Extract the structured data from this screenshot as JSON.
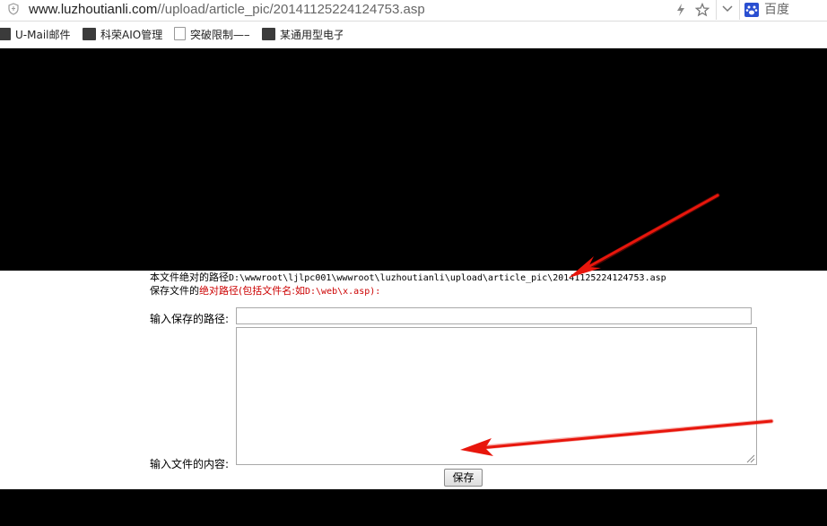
{
  "browser": {
    "url": {
      "host": "www.luzhoutianli.com",
      "path": "//upload/article_pic/20141125224124753.asp"
    },
    "search_engine": {
      "name": "百度",
      "icon": "paw-icon"
    },
    "actions": [
      {
        "name": "bolt-icon"
      },
      {
        "name": "star-icon"
      },
      {
        "name": "chevron-down-icon"
      }
    ],
    "bookmarks": [
      {
        "label": "U-Mail邮件"
      },
      {
        "label": "科荣AIO管理"
      },
      {
        "label": "突破限制——"
      },
      {
        "label": "某通用型电子"
      }
    ]
  },
  "page": {
    "abs_path_label": "本文件绝对的路径",
    "abs_path_value": "D:\\wwwroot\\ljlpc001\\wwwroot\\luzhoutianli\\upload\\article_pic\\20141125224124753.asp",
    "save_hint_prefix": "保存文件的",
    "save_hint_red": "绝对路径(包括文件名:如",
    "save_hint_example": "D:\\web\\x.asp):",
    "path_label": "输入保存的路径:",
    "path_value": "",
    "content_label": "输入文件的内容:",
    "content_value": "",
    "save_button": "保存"
  },
  "colors": {
    "black_panel": "#000000",
    "hint_red": "#cc0000",
    "annotation_arrow": "#e8160c",
    "search_icon_blue": "#2a4fd1"
  }
}
